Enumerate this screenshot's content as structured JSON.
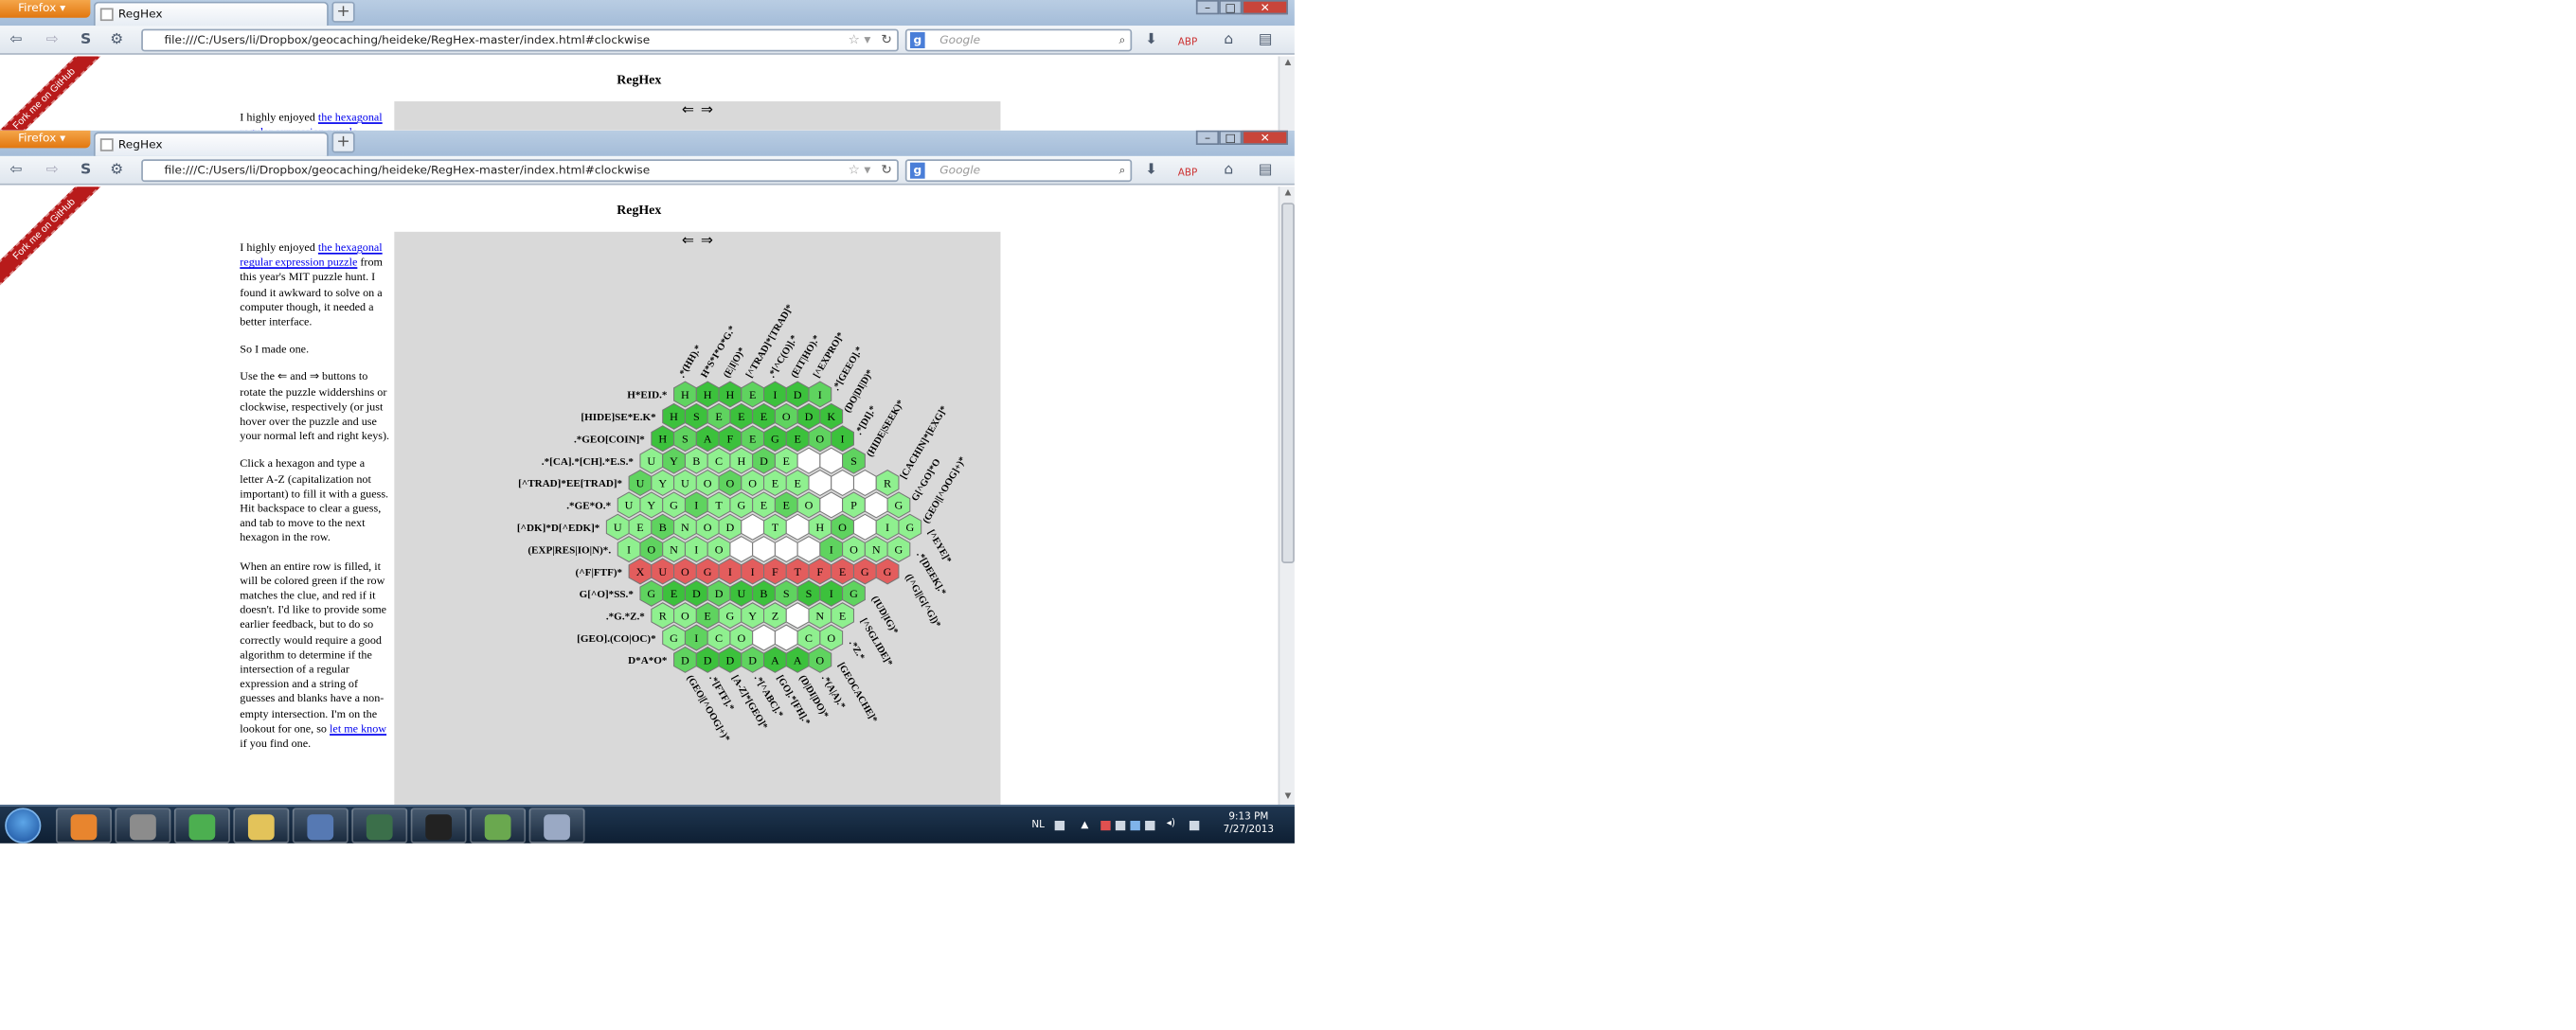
{
  "browser": {
    "menu_label": "Firefox",
    "tab_title": "RegHex",
    "new_tab_symbol": "+",
    "url": "file:///C:/Users/li/Dropbox/geocaching/heideke/RegHex-master/index.html#clockwise",
    "search_placeholder": "Google",
    "nav_symbols": {
      "back": "⇦",
      "forward": "⇨",
      "home": "⌂",
      "download": "⬇",
      "abp": "ABP"
    }
  },
  "ribbon": {
    "label": "Fork me on GitHub"
  },
  "page": {
    "title": "RegHex",
    "rotate_left": "⇐",
    "rotate_right": "⇒",
    "intro_pre": "I highly enjoyed ",
    "intro_link": "the hexagonal regular expression puzzle",
    "intro_post": " from this year's MIT puzzle hunt. I found it awkward to solve on a computer though, it needed a better interface.",
    "p2": "So I made one.",
    "p3": "Use the ⇐ and ⇒ buttons to rotate the puzzle widdershins or clockwise, respectively (or just hover over the puzzle and use your normal left and right keys).",
    "p4": "Click a hexagon and type a letter A-Z (capitalization not important) to fill it with a guess. Hit backspace to clear a guess, and tab to move to the next hexagon in the row.",
    "p5_pre": "When an entire row is filled, it will be colored green if the row matches the clue, and red if it doesn't. I'd like to provide some earlier feedback, but to do so correctly would require a good algorithm to determine if the intersection of a regular expression and a string of guesses and blanks have a non-empty intersection. I'm on the lookout for one, so ",
    "p5_link": "let me know",
    "p5_post": " if you find one."
  },
  "puzzle": {
    "rows": [
      {
        "clue": "H*EID.*",
        "cells": "HHHEIDI",
        "state": "green"
      },
      {
        "clue": "[HIDE]SE*E.K*",
        "cells": "HSEEEODK",
        "state": "green"
      },
      {
        "clue": ".*GEO[COIN]*",
        "cells": "HSAFEGEOI",
        "state": "green"
      },
      {
        "clue": ".*[CA].*[CH].*E.S.*",
        "cells": "UYBCHDE__S",
        "state": "partial"
      },
      {
        "clue": "[^TRAD]*EE[TRAD]*",
        "cells": "UYUOOOEE___R",
        "state": "partial"
      },
      {
        "clue": ".*GE*O.*",
        "cells": "UYGITGEEO_P_G",
        "state": "partial"
      },
      {
        "clue": "[^DK]*D[^EDK]*",
        "cells": "UEBNOD_T_HO_IG",
        "state": "partial"
      },
      {
        "clue": "(EXP|RES|IO|N)*.",
        "cells": "IONIO____IONG",
        "state": "partial"
      },
      {
        "clue": "(^F|FTF)*",
        "cells": "XUOGIIFTFEGG",
        "state": "red"
      },
      {
        "clue": "G[^O]*SS.*",
        "cells": "GEDDUBSSIG",
        "state": "green"
      },
      {
        "clue": ".*G.*Z.*",
        "cells": "ROEGYZ_NE",
        "state": "partial"
      },
      {
        "clue": "[GEO].(CO|OC)*",
        "cells": "GICO__CO",
        "state": "partial"
      },
      {
        "clue": "D*A*O*",
        "cells": "DDDDAAO",
        "state": "green"
      }
    ],
    "top_clues": [
      ".*(HH).*",
      "H*S*I*O*G.*",
      "(E|I|O)*",
      "[^TRAD]*[TRAD]*",
      ".*[^C(O)].*",
      "(EIT|HO).*",
      "[^EXPRO]*"
    ],
    "top_right_clues": [
      ".*[GEEO].*",
      "(DO|DI|D)*",
      ".*[DI].*",
      "(HIDE|SEEK)*",
      "[CACHIN]*[EXG]*",
      "G[^GO]*O",
      "(GEO|[^OOG]+)*"
    ],
    "bottom_clues": [
      "(GEO|[^OOG]+)*",
      ".*[FTF].*",
      "[A-Z]*[GEO]*",
      ".*[^ABC].*",
      "[GO].*[FH].*",
      "(D|DI|DO)*",
      ".*(A|A).*"
    ],
    "bottom_right_clues": [
      "[^EYE]*",
      ".*[DEEK].*",
      "([^G]|G[^G])*",
      "(IUD|IG)*",
      "[^SGLIDE]*",
      ".*Z.*",
      "[GEOCACHE]*"
    ]
  },
  "taskbar": {
    "apps": [
      "firefox",
      "unknown-app",
      "chrome",
      "explorer",
      "security",
      "monitor",
      "cmd",
      "chart",
      "paint"
    ],
    "lang": "NL",
    "time": "9:13 PM",
    "date": "7/27/2013"
  },
  "colors": {
    "green_dark": "#3cc13c",
    "green_light": "#8ff08f",
    "red": "#e35d5d",
    "white_cell": "#ffffff",
    "panel": "#d9d9d9"
  }
}
